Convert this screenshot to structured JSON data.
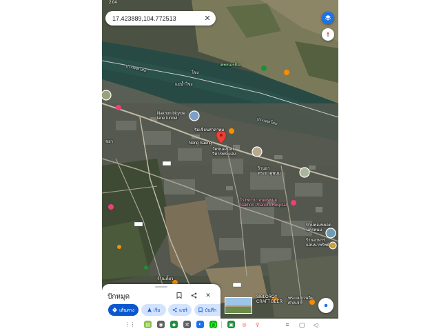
{
  "status_bar": {
    "time": "2:04"
  },
  "search": {
    "query": "17.423889,104.772513"
  },
  "map": {
    "labels": {
      "country_north": "ประเทศไทย",
      "river_small_1": "โขง",
      "river_small_2": "แม่น้ำโขง",
      "country_south": "ประเทศไทย",
      "laos_top": "ສະຫມາຄົມ",
      "poi_cross": "ຮອດແຜ່ນດິນ ນະຄອນ\nແຂວງຄຳມ່ວນ",
      "bicycle_tunnel": "Nakhon bicycle\nlane tunnel",
      "pin_title": "ริมเขื่อนศาลาพม",
      "nong_saeng": "Nong Saeng",
      "temple": "วัดหนองแสง\nวิหารพระแสง",
      "shop_1": "ร้านยา\nพระธาตุพนม",
      "park": "นครพนม\nหลวงพ่อพระใส",
      "hospital": "โรงพยาบาลนครพนม\nNakhon Phanom Hospital",
      "road_left": "ชยา",
      "road_mid": "เว",
      "shop_right_1": "บ้านทองหยอด\nนครพนม",
      "shop_right_2": "ร้านอาหาร\nแอนนาทรัพย์",
      "cafe_bottom": "SIBLOROY\nCRAFT BEER",
      "bottom_right": "พระแม่กวนอิม\nศาลเจ้า",
      "bottom_left": "ร้านเตี๋ยว"
    }
  },
  "bottom_sheet": {
    "title": "ปักหมุด",
    "actions": {
      "directions": "เส้นทาง",
      "start": "เริ่ม",
      "share": "แชร์",
      "save": "บันทึก"
    }
  },
  "colors": {
    "accent": "#0b57d0",
    "accent_tonal": "#d3e3fd",
    "pin": "#ea4335"
  }
}
